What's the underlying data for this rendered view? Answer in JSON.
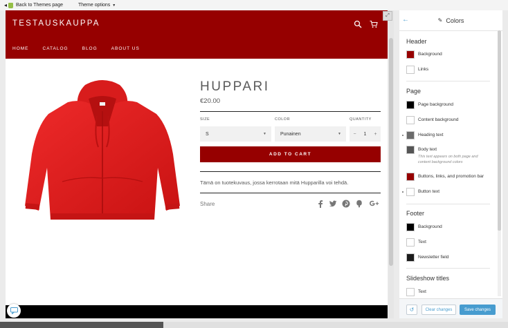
{
  "topbar": {
    "back_label": "Back to Themes page",
    "theme_options_label": "Theme options"
  },
  "store": {
    "title": "TESTAUSKAUPPA",
    "nav": [
      "HOME",
      "CATALOG",
      "BLOG",
      "ABOUT US"
    ],
    "accent_color": "#960000"
  },
  "product": {
    "title": "HUPPARI",
    "price": "€20.00",
    "size_label": "SIZE",
    "size_value": "S",
    "color_label": "COLOR",
    "color_value": "Punainen",
    "quantity_label": "QUANTITY",
    "quantity_value": "1",
    "qty_minus": "−",
    "qty_plus": "+",
    "add_to_cart": "ADD TO CART",
    "description": "Tämä on tuotekuvaus, jossa kerrotaan mitä Hupparilla voi tehdä.",
    "share_label": "Share",
    "social_icons": [
      "facebook-icon",
      "twitter-icon",
      "pinterest-icon",
      "fancy-icon",
      "google-plus-icon"
    ]
  },
  "panel": {
    "title": "Colors",
    "sections": {
      "header": {
        "title": "Header",
        "items": [
          {
            "label": "Background",
            "color": "#960000"
          },
          {
            "label": "Links",
            "color": "#ffffff"
          }
        ]
      },
      "page": {
        "title": "Page",
        "items": [
          {
            "label": "Page background",
            "color": "#000000"
          },
          {
            "label": "Content background",
            "color": "#ffffff"
          },
          {
            "label": "Heading text",
            "color": "#6b6b6b"
          },
          {
            "label": "Body text",
            "color": "#555555",
            "note": "This text appears on both page and content background colors"
          },
          {
            "label": "Buttons, links, and promotion bar",
            "color": "#960000"
          },
          {
            "label": "Button text",
            "color": "#ffffff"
          }
        ]
      },
      "footer": {
        "title": "Footer",
        "items": [
          {
            "label": "Background",
            "color": "#000000"
          },
          {
            "label": "Text",
            "color": "#ffffff"
          },
          {
            "label": "Newsletter field",
            "color": "#1c1c1c"
          }
        ]
      },
      "slideshow": {
        "title": "Slideshow titles",
        "items": [
          {
            "label": "Text",
            "color": "#ffffff"
          }
        ]
      }
    },
    "footer": {
      "clear_label": "Clear changes",
      "save_label": "Save changes"
    },
    "link_color": "#479ccf"
  }
}
